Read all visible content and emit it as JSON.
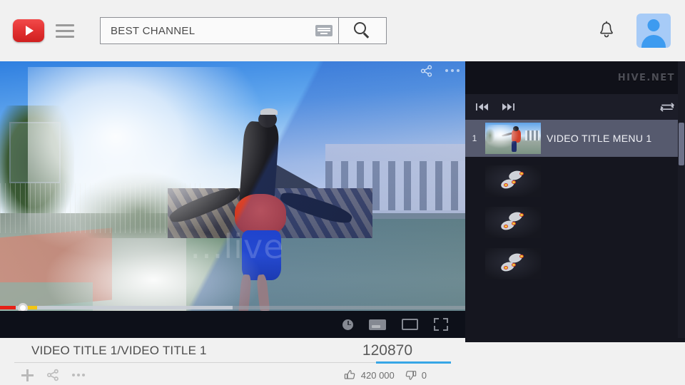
{
  "header": {
    "logo_name": "youtube-logo",
    "menu_label": "menu",
    "search": {
      "value": "BEST CHANNEL",
      "placeholder": "Search",
      "keyboard_icon": "keyboard-icon",
      "search_icon": "search-icon"
    },
    "notifications_icon": "bell-icon",
    "account_icon": "user-avatar"
  },
  "player": {
    "watermark": "...live",
    "share_icon": "share-icon",
    "more_icon": "more-options-icon",
    "progress": {
      "played_percent": 3.4,
      "buffered_percent": 50,
      "chapter_marker_percent": 5.6
    },
    "controls": [
      {
        "name": "settings-icon",
        "label": "Settings"
      },
      {
        "name": "subtitles-icon",
        "label": "Subtitles"
      },
      {
        "name": "theater-mode-icon",
        "label": "Theater mode"
      },
      {
        "name": "fullscreen-icon",
        "label": "Fullscreen"
      }
    ]
  },
  "playlist": {
    "brand": "HIVE.NET",
    "controls": {
      "previous": "previous-track-icon",
      "next": "next-track-icon",
      "loop": "loop-icon"
    },
    "items": [
      {
        "index": "1",
        "title": "VIDEO TITLE MENU 1",
        "thumb": "photo",
        "active": true
      },
      {
        "index": "",
        "title": "",
        "thumb": "broken",
        "active": false
      },
      {
        "index": "",
        "title": "",
        "thumb": "broken",
        "active": false
      },
      {
        "index": "",
        "title": "",
        "thumb": "broken",
        "active": false
      }
    ]
  },
  "meta": {
    "title": "VIDEO TITLE 1/VIDEO TITLE 1",
    "views": "120870",
    "accent_color": "#37a6e6",
    "actions": [
      {
        "name": "add-to-playlist-icon",
        "label": "Add"
      },
      {
        "name": "share-icon",
        "label": "Share"
      },
      {
        "name": "more-options-icon",
        "label": "More"
      }
    ],
    "likes": "420 000",
    "dislikes": "0",
    "like_icon": "thumbs-up-icon",
    "dislike_icon": "thumbs-down-icon"
  }
}
